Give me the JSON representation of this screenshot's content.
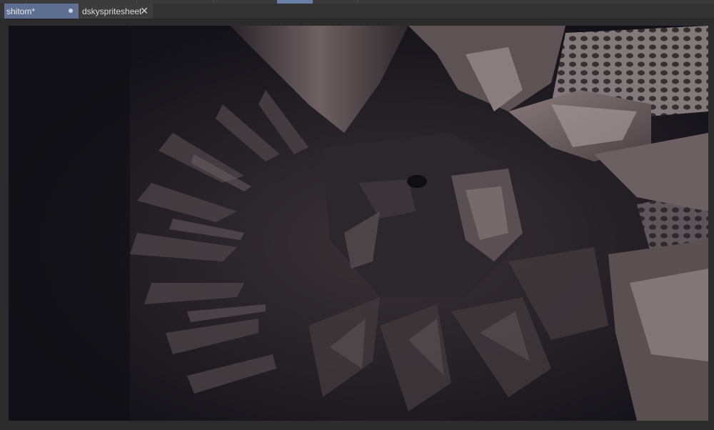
{
  "tabs": [
    {
      "label": "shitom*",
      "active": true,
      "modified_indicator": "dot"
    },
    {
      "label": "dskyspritesheet",
      "active": false,
      "close_icon": "close-icon"
    }
  ],
  "colors": {
    "active_tab": "#5f6f92",
    "workspace": "#2b2b2b",
    "canvas_background": "#131319"
  }
}
